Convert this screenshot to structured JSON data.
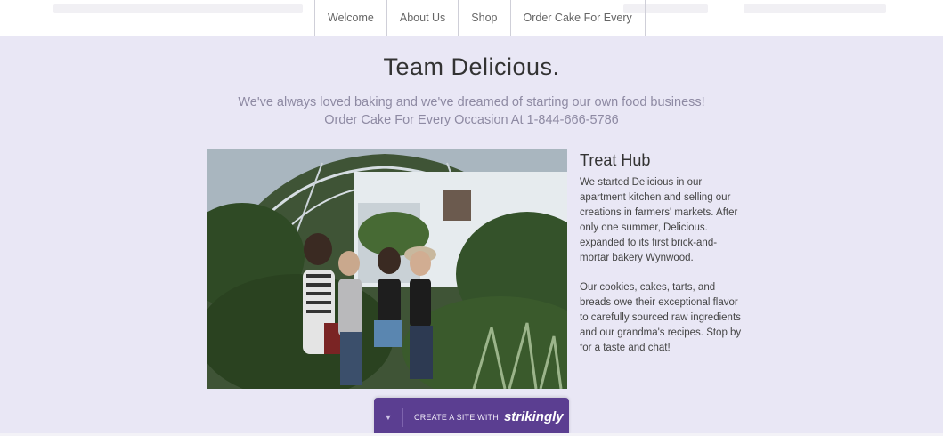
{
  "nav": {
    "items": [
      "Welcome",
      "About Us",
      "Shop",
      "Order Cake For Every"
    ]
  },
  "hero": {
    "title": "Team Delicious.",
    "subtitle_line1": "We've always loved baking and we've dreamed of starting our own food business!",
    "subtitle_line2": "Order Cake For Every Occasion At 1-844-666-5786"
  },
  "sidebar": {
    "title": "Treat Hub",
    "paragraph1": "We started Delicious in our apartment kitchen and selling our creations in farmers' markets. After only one summer, Delicious. expanded to its first brick-and-mortar bakery Wynwood.",
    "paragraph2": "Our cookies, cakes, tarts, and breads owe their exceptional flavor to carefully sourced raw ingredients and our grandma's recipes. Stop by for a taste and chat!"
  },
  "badge": {
    "caret": "▼",
    "label": "CREATE A SITE WITH",
    "brand": "strikingly"
  },
  "colors": {
    "background": "#e9e7f5",
    "badge": "#5b3e91"
  }
}
